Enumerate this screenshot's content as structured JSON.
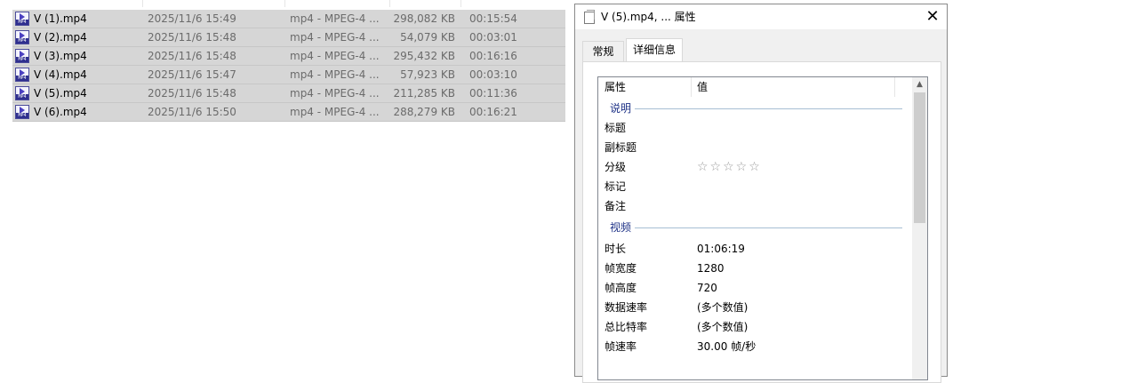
{
  "files": [
    {
      "name": "V (1).mp4",
      "date": "2025/11/6 15:49",
      "type": "mp4 - MPEG-4 ...",
      "size": "298,082 KB",
      "duration": "00:15:54"
    },
    {
      "name": "V (2).mp4",
      "date": "2025/11/6 15:48",
      "type": "mp4 - MPEG-4 ...",
      "size": "54,079 KB",
      "duration": "00:03:01"
    },
    {
      "name": "V (3).mp4",
      "date": "2025/11/6 15:48",
      "type": "mp4 - MPEG-4 ...",
      "size": "295,432 KB",
      "duration": "00:16:16"
    },
    {
      "name": "V (4).mp4",
      "date": "2025/11/6 15:47",
      "type": "mp4 - MPEG-4 ...",
      "size": "57,923 KB",
      "duration": "00:03:10"
    },
    {
      "name": "V (5).mp4",
      "date": "2025/11/6 15:48",
      "type": "mp4 - MPEG-4 ...",
      "size": "211,285 KB",
      "duration": "00:11:36"
    },
    {
      "name": "V (6).mp4",
      "date": "2025/11/6 15:50",
      "type": "mp4 - MPEG-4 ...",
      "size": "288,279 KB",
      "duration": "00:16:21"
    }
  ],
  "file_icon": "mp4-file-icon",
  "file_icon_tag": "MP4",
  "dialog": {
    "title": "V (5).mp4, ... 属性",
    "close_glyph": "✕",
    "tabs": {
      "general": "常规",
      "details": "详细信息"
    },
    "columns": {
      "property": "属性",
      "value": "值"
    },
    "groups": {
      "description": "说明",
      "video": "视频"
    },
    "description": {
      "title": "标题",
      "subtitle": "副标题",
      "rating": "分级",
      "rating_stars": "☆☆☆☆☆",
      "tags": "标记",
      "comments": "备注"
    },
    "video": [
      {
        "key": "时长",
        "value": "01:06:19"
      },
      {
        "key": "帧宽度",
        "value": "1280"
      },
      {
        "key": "帧高度",
        "value": "720"
      },
      {
        "key": "数据速率",
        "value": "(多个数值)"
      },
      {
        "key": "总比特率",
        "value": "(多个数值)"
      },
      {
        "key": "帧速率",
        "value": "30.00 帧/秒"
      }
    ],
    "scroll_up_glyph": "▲"
  },
  "colors": {
    "selection": "#d6d6d6",
    "group_label": "#1e3287",
    "dialog_bg": "#f0f0f0"
  }
}
